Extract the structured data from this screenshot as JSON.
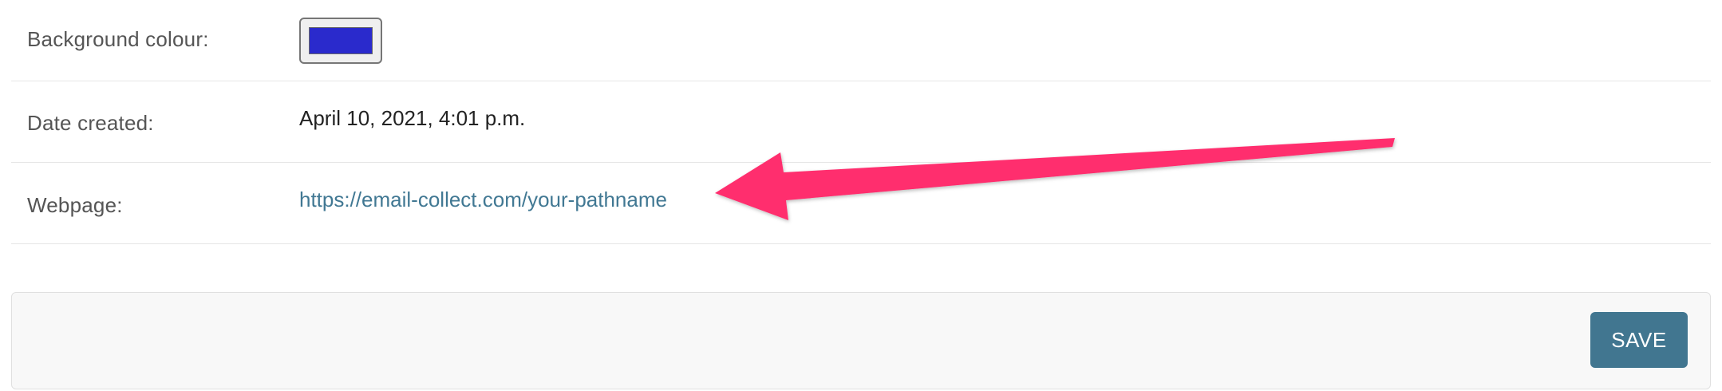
{
  "form": {
    "background_colour": {
      "label": "Background colour:",
      "value": "#2a2acc"
    },
    "date_created": {
      "label": "Date created:",
      "value": "April 10, 2021, 4:01 p.m."
    },
    "webpage": {
      "label": "Webpage:",
      "value": "https://email-collect.com/your-pathname"
    }
  },
  "submit": {
    "save_label": "SAVE"
  },
  "annotation": {
    "arrow_color": "#ff2f6e",
    "arrow_target": "webpage-link"
  }
}
